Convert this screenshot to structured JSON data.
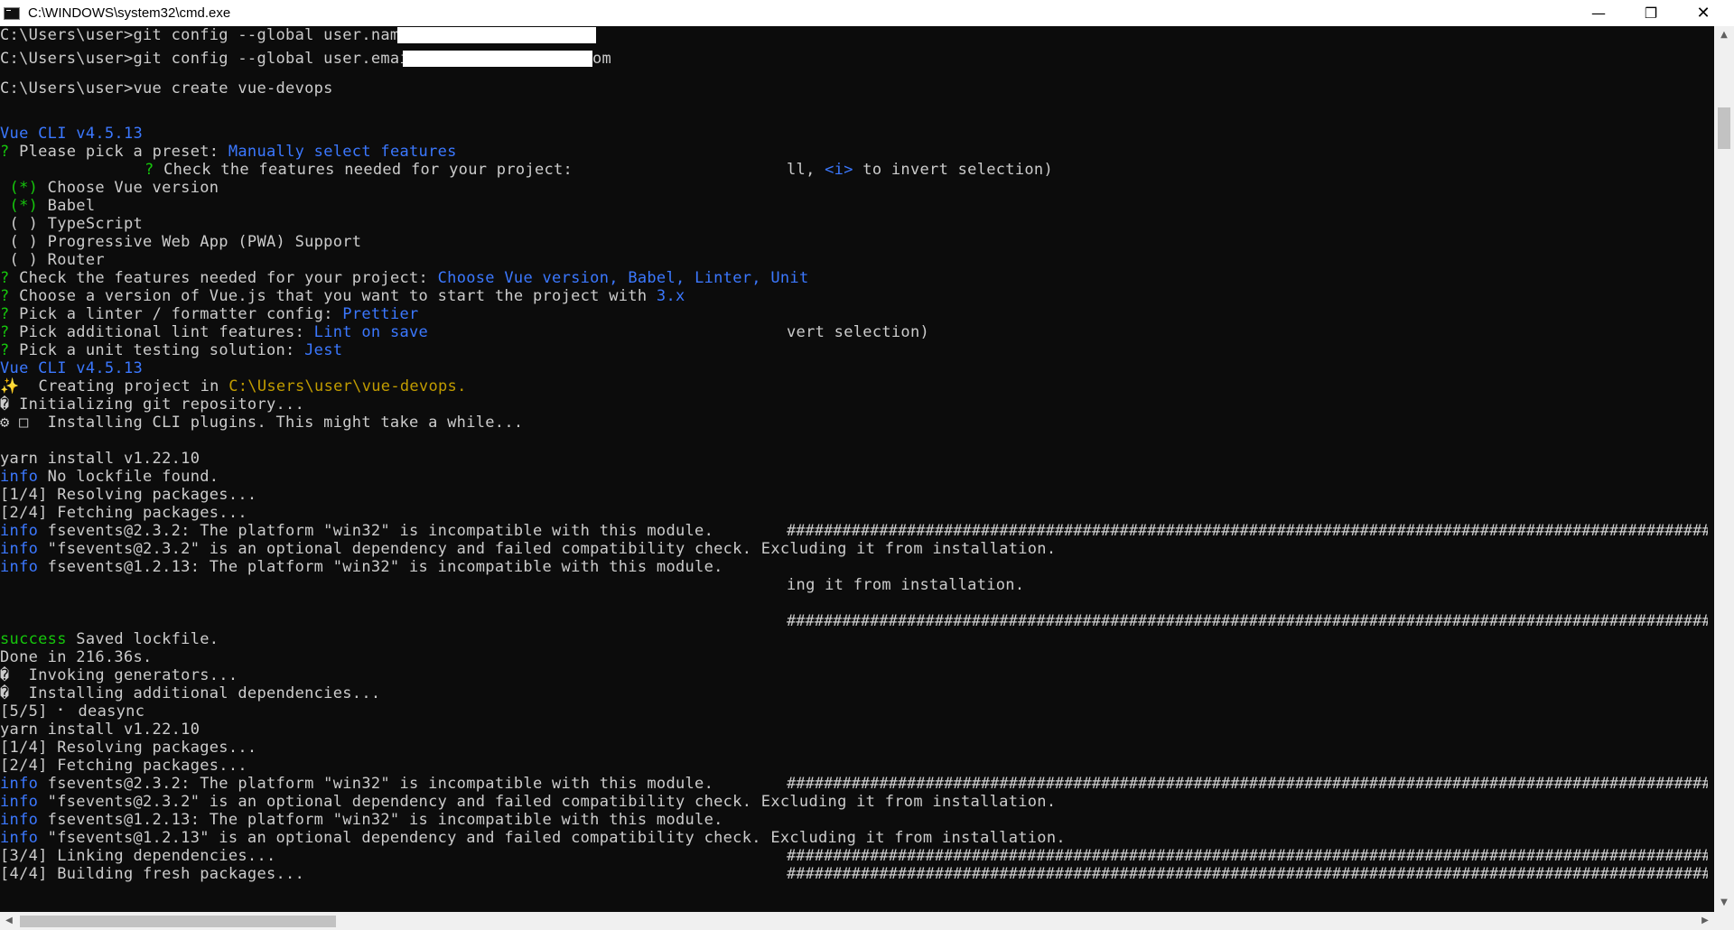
{
  "window": {
    "title": "C:\\WINDOWS\\system32\\cmd.exe",
    "minimize_glyph": "—",
    "maximize_glyph": "❐",
    "close_glyph": "✕"
  },
  "icons": {
    "app": "cmd-icon",
    "minimize": "minimize-icon",
    "maximize": "restore-icon",
    "close": "close-icon"
  },
  "colors": {
    "console_bg": "#0c0c0c",
    "text": "#cccccc",
    "blue": "#3b78ff",
    "green": "#16c60c",
    "yellow": "#c19c00"
  },
  "console": {
    "l1": "C:\\Users\\user>git config --global user.name ",
    "l2": "C:\\Users\\user>git config --global user.email ",
    "l2_tail": "om",
    "l3": "C:\\Users\\user>vue create vue-devops",
    "vue_cli": "Vue CLI v4.5.13",
    "preset_q": "?",
    "preset_label": " Please pick a preset: ",
    "preset_value": "Manually select features",
    "check_q": "?",
    "check_label": " Check the features needed for your project: ",
    "check_tail_a": "ll, ",
    "check_tail_i": "<i>",
    "check_tail_b": " to invert selection)",
    "opt1_mark": " (*)",
    "opt1": " Choose Vue version",
    "opt2_mark": " (*)",
    "opt2": " Babel",
    "opt3": " ( ) TypeScript",
    "opt4": " ( ) Progressive Web App (PWA) Support",
    "opt5": " ( ) Router",
    "ans1_q": "?",
    "ans1_label": " Check the features needed for your project: ",
    "ans1_value": "Choose Vue version, Babel, Linter, Unit",
    "ans2_q": "?",
    "ans2_label": " Choose a version of Vue.js that you want to start the project with ",
    "ans2_value": "3.x",
    "ans3_q": "?",
    "ans3_label": " Pick a linter / formatter config: ",
    "ans3_value": "Prettier",
    "ans4_q": "?",
    "ans4_label": " Pick additional lint features: ",
    "ans4_value": "Lint on save",
    "ans4_tail": "vert selection)",
    "ans5_q": "?",
    "ans5_label": " Pick a unit testing solution: ",
    "ans5_value": "Jest",
    "vue_cli2": "Vue CLI v4.5.13",
    "creating_a": "✨  Creating project in ",
    "creating_path": "C:\\Users\\user\\vue-devops.",
    "init_git": "� Initializing git repository...",
    "installing": "⚙ □  Installing CLI plugins. This might take a while...",
    "yarn1": "yarn install v1.22.10",
    "info1_tag": "info",
    "info1": " No lockfile found.",
    "step1": "[1/4] Resolving packages...",
    "step2": "[2/4] Fetching packages...",
    "info2_tag": "info",
    "info2": " fsevents@2.3.2: The platform \"win32\" is incompatible with this module.",
    "info3_tag": "info",
    "info3": " \"fsevents@2.3.2\" is an optional dependency and failed compatibility check. Excluding it from installation.",
    "info4_tag": "info",
    "info4": " fsevents@1.2.13: The platform \"win32\" is incompatible with this module.",
    "excl_tail": "ing it from installation.",
    "success_tag": "success",
    "success": " Saved lockfile.",
    "done": "Done in 216.36s.",
    "invoking": "�  Invoking generators...",
    "inst_add": "�  Installing additional dependencies...",
    "step5": "[5/5] ⠂ deasync",
    "yarn2": "yarn install v1.22.10",
    "step1b": "[1/4] Resolving packages...",
    "step2b": "[2/4] Fetching packages...",
    "info5_tag": "info",
    "info5": " fsevents@2.3.2: The platform \"win32\" is incompatible with this module.",
    "info6_tag": "info",
    "info6": " \"fsevents@2.3.2\" is an optional dependency and failed compatibility check. Excluding it from installation.",
    "info7_tag": "info",
    "info7": " fsevents@1.2.13: The platform \"win32\" is incompatible with this module.",
    "info8_tag": "info",
    "info8": " \"fsevents@1.2.13\" is an optional dependency and failed compatibility check. Excluding it from installation.",
    "step3b": "[3/4] Linking dependencies...",
    "step4b": "[4/4] Building fresh packages...",
    "hashes": "###################################################################################################################################"
  },
  "scrollbars": {
    "up": "▲",
    "down": "▼",
    "left": "◀",
    "right": "▶"
  }
}
